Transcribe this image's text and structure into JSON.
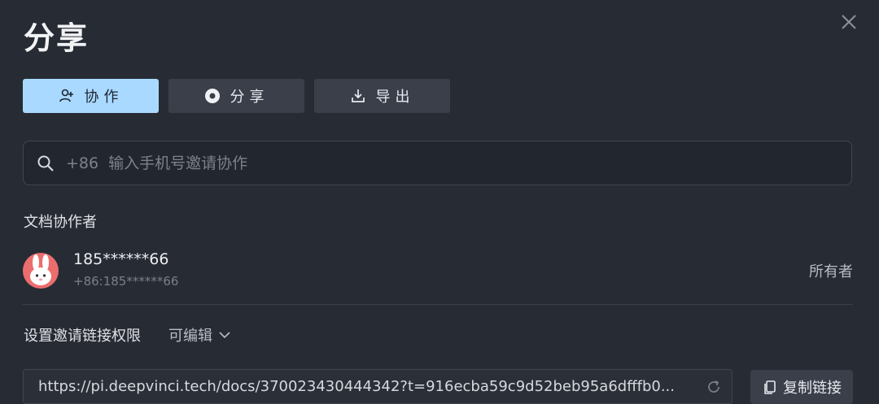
{
  "dialog": {
    "title": "分享"
  },
  "tabs": [
    {
      "label": "协作",
      "icon": "add-user-icon",
      "active": true
    },
    {
      "label": "分享",
      "icon": "share-icon",
      "active": false
    },
    {
      "label": "导出",
      "icon": "download-icon",
      "active": false
    }
  ],
  "search": {
    "placeholder": "+86  输入手机号邀请协作"
  },
  "collaborators": {
    "label": "文档协作者",
    "items": [
      {
        "name": "185******66",
        "phone": "+86:185******66",
        "role": "所有者"
      }
    ]
  },
  "invite": {
    "label": "设置邀请链接权限",
    "permission": "可编辑",
    "link": "https://pi.deepvinci.tech/docs/370023430444342?t=916ecba59c9d52beb95a6dfffb0...",
    "copy_label": "复制链接"
  },
  "colors": {
    "background": "#272b34",
    "accent": "#a9d9ff",
    "avatar": "#ec6d6d"
  }
}
